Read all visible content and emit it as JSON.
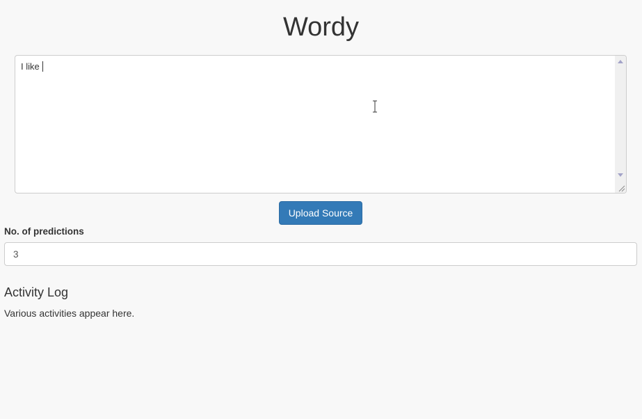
{
  "app": {
    "title": "Wordy"
  },
  "editor": {
    "value": "I like "
  },
  "upload": {
    "label": "Upload Source"
  },
  "predictions": {
    "label": "No. of predictions",
    "value": "3"
  },
  "activity": {
    "heading": "Activity Log",
    "text": "Various activities appear here."
  },
  "colors": {
    "primary_button": "#337ab7",
    "background": "#f8f8f8"
  },
  "icons": {
    "cursor": "text-cursor-icon",
    "scroll_up": "scroll-up-arrow-icon",
    "scroll_down": "scroll-down-arrow-icon",
    "resize": "resize-handle-icon"
  }
}
